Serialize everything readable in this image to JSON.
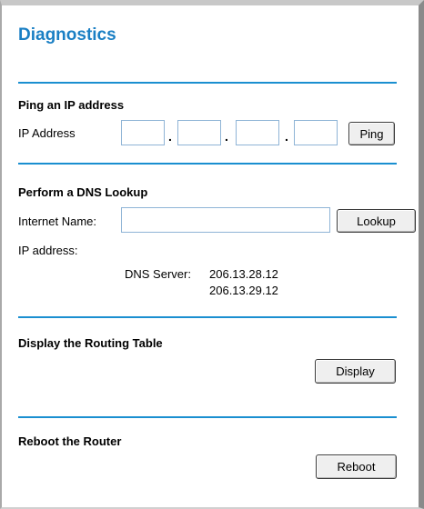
{
  "page": {
    "title": "Diagnostics"
  },
  "ping": {
    "heading": "Ping an IP address",
    "ip_label": "IP Address",
    "octets": [
      "",
      "",
      "",
      ""
    ],
    "separator": ".",
    "button_label": "Ping"
  },
  "dns": {
    "heading": "Perform a DNS Lookup",
    "name_label": "Internet Name:",
    "name_value": "",
    "button_label": "Lookup",
    "ip_label": "IP address:",
    "ip_value": "",
    "server_label": "DNS Server:",
    "servers": [
      "206.13.28.12",
      "206.13.29.12"
    ]
  },
  "routing": {
    "heading": "Display the Routing Table",
    "button_label": "Display"
  },
  "reboot": {
    "heading": "Reboot the Router",
    "button_label": "Reboot"
  }
}
